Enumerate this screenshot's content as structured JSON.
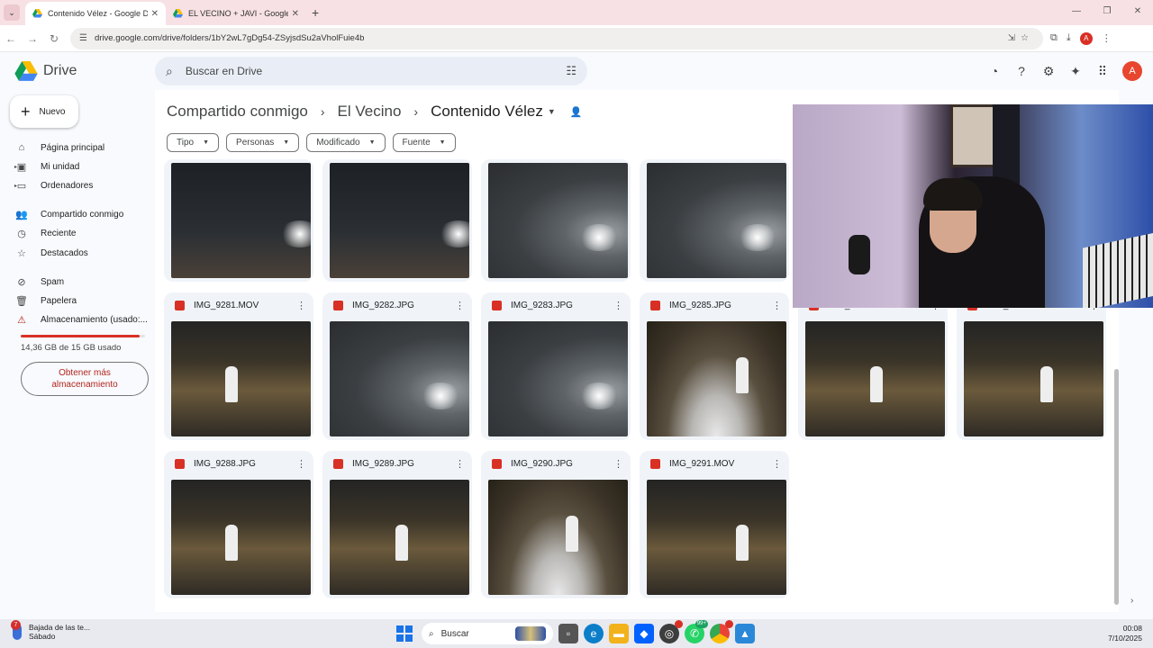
{
  "browser": {
    "tabs": [
      {
        "title": "Contenido Vélez - Google Drive",
        "active": true
      },
      {
        "title": "EL VECINO + JAVI - Google Dri",
        "active": false
      }
    ],
    "new_tab": "+",
    "url": "drive.google.com/drive/folders/1bY2wL7gDg54-ZSyjsdSu2aVholFuie4b",
    "profile_initial": "A"
  },
  "drive": {
    "app_name": "Drive",
    "search_placeholder": "Buscar en Drive",
    "account_initial": "A",
    "accent": "#0b57d0"
  },
  "sidebar": {
    "new_label": "Nuevo",
    "items": [
      {
        "label": "Página principal",
        "icon": "home-icon"
      },
      {
        "label": "Mi unidad",
        "icon": "my-drive-icon"
      },
      {
        "label": "Ordenadores",
        "icon": "computer-icon"
      },
      {
        "label": "Compartido conmigo",
        "icon": "shared-icon"
      },
      {
        "label": "Reciente",
        "icon": "clock-icon"
      },
      {
        "label": "Destacados",
        "icon": "star-icon"
      },
      {
        "label": "Spam",
        "icon": "spam-icon"
      },
      {
        "label": "Papelera",
        "icon": "trash-icon"
      },
      {
        "label": "Almacenamiento (usado:...",
        "icon": "warning-icon"
      }
    ],
    "storage_text": "14,36 GB de 15 GB usado",
    "storage_fraction": 0.957,
    "get_more": "Obtener más almacenamiento"
  },
  "breadcrumb": {
    "items": [
      "Compartido conmigo",
      "El Vecino",
      "Contenido Vélez"
    ]
  },
  "filters": [
    "Tipo",
    "Personas",
    "Modificado",
    "Fuente"
  ],
  "files": {
    "row1": [
      {
        "name": "",
        "thumb": "night"
      },
      {
        "name": "",
        "thumb": "night"
      },
      {
        "name": "",
        "thumb": "fog"
      },
      {
        "name": "",
        "thumb": "fog"
      }
    ],
    "row2": [
      {
        "name": "IMG_9281.MOV",
        "thumb": "crowd"
      },
      {
        "name": "IMG_9282.JPG",
        "thumb": "fog"
      },
      {
        "name": "IMG_9283.JPG",
        "thumb": "fog"
      },
      {
        "name": "IMG_9285.JPG",
        "thumb": "crowd-light"
      },
      {
        "name": "IMG_9286.JPG",
        "thumb": "crowd"
      },
      {
        "name": "IMG_9287.JPG",
        "thumb": "crowd"
      }
    ],
    "row3": [
      {
        "name": "IMG_9288.JPG",
        "thumb": "crowd"
      },
      {
        "name": "IMG_9289.JPG",
        "thumb": "crowd"
      },
      {
        "name": "IMG_9290.JPG",
        "thumb": "crowd-light"
      },
      {
        "name": "IMG_9291.MOV",
        "thumb": "crowd"
      }
    ]
  },
  "taskbar": {
    "weather_line1": "Bajada de las te...",
    "weather_line2": "Sábado",
    "weather_badge": "7",
    "search_label": "Buscar",
    "whatsapp_badge": "99+",
    "time": "00:08",
    "date": "7/10/2025"
  }
}
